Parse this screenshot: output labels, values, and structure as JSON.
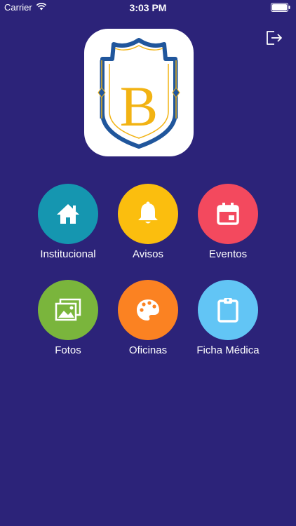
{
  "status_bar": {
    "carrier": "Carrier",
    "time": "3:03 PM"
  },
  "logo": {
    "letter": "B"
  },
  "menu": [
    {
      "label": "Institucional",
      "icon": "home-icon",
      "color": "#1596b0"
    },
    {
      "label": "Avisos",
      "icon": "bell-icon",
      "color": "#fbbe0e"
    },
    {
      "label": "Eventos",
      "icon": "calendar-icon",
      "color": "#f3495e"
    },
    {
      "label": "Fotos",
      "icon": "photos-icon",
      "color": "#7ab53c"
    },
    {
      "label": "Oficinas",
      "icon": "palette-icon",
      "color": "#fb8222"
    },
    {
      "label": "Ficha Médica",
      "icon": "clipboard-icon",
      "color": "#62c5f5"
    }
  ],
  "colors": {
    "background": "#2c2379",
    "logo_blue": "#20569c",
    "logo_gold": "#f2b313"
  }
}
